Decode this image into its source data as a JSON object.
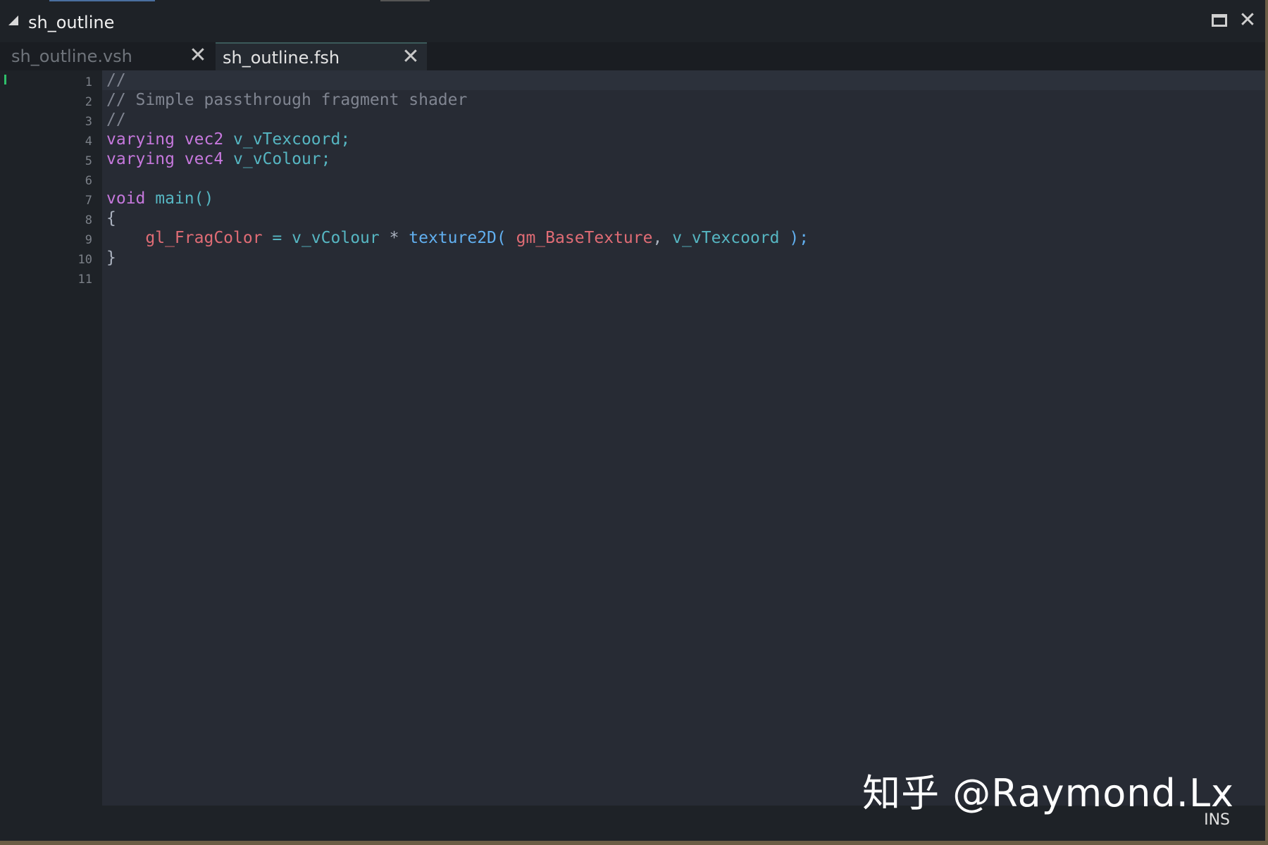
{
  "window": {
    "title": "sh_outline",
    "maximize_icon": "maximize-icon",
    "close_icon": "close-icon"
  },
  "tabs": [
    {
      "label": "sh_outline.vsh",
      "active": false,
      "close_symbol": "✕"
    },
    {
      "label": "sh_outline.fsh",
      "active": true,
      "close_symbol": "✕"
    }
  ],
  "editor": {
    "line_numbers": [
      "1",
      "2",
      "3",
      "4",
      "5",
      "6",
      "7",
      "8",
      "9",
      "10",
      "11"
    ],
    "lines": [
      [
        {
          "t": "//",
          "c": "comment"
        }
      ],
      [
        {
          "t": "// Simple passthrough fragment shader",
          "c": "comment"
        }
      ],
      [
        {
          "t": "//",
          "c": "comment"
        }
      ],
      [
        {
          "t": "varying vec2 ",
          "c": "keyword"
        },
        {
          "t": "v_vTexcoord;",
          "c": "ident"
        }
      ],
      [
        {
          "t": "varying vec4 ",
          "c": "keyword"
        },
        {
          "t": "v_vColour;",
          "c": "ident"
        }
      ],
      [],
      [
        {
          "t": "void ",
          "c": "keyword"
        },
        {
          "t": "main()",
          "c": "ident"
        }
      ],
      [
        {
          "t": "{",
          "c": "punct"
        }
      ],
      [
        {
          "t": "    ",
          "c": "punct"
        },
        {
          "t": "gl_FragColor",
          "c": "builtin"
        },
        {
          "t": " = ",
          "c": "ident"
        },
        {
          "t": "v_vColour",
          "c": "ident"
        },
        {
          "t": " * ",
          "c": "punct"
        },
        {
          "t": "texture2D( ",
          "c": "func"
        },
        {
          "t": "gm_BaseTexture",
          "c": "builtin"
        },
        {
          "t": ", ",
          "c": "punct"
        },
        {
          "t": "v_vTexcoord",
          "c": "ident"
        },
        {
          "t": " );",
          "c": "func"
        }
      ],
      [
        {
          "t": "}",
          "c": "punct"
        }
      ],
      []
    ]
  },
  "status": {
    "mode": "INS"
  },
  "watermark": "知乎 @Raymond.Lx"
}
